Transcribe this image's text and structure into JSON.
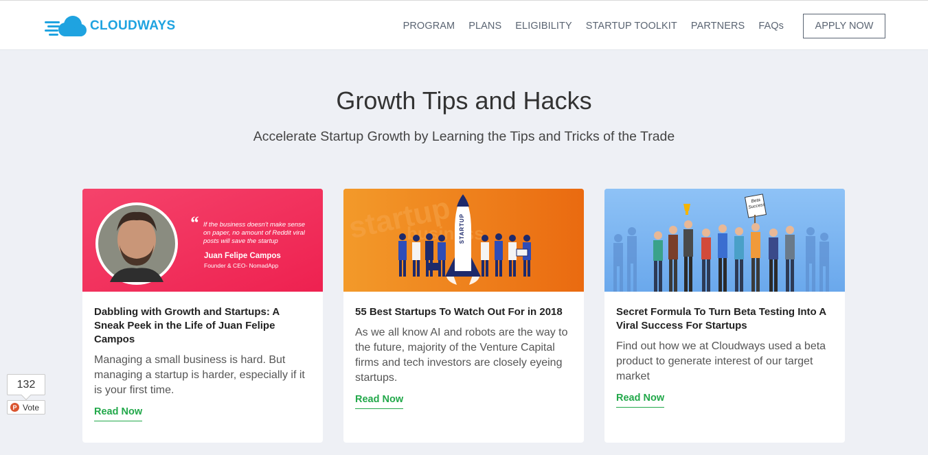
{
  "header": {
    "logo_text": "CLOUDWAYS",
    "nav": [
      "PROGRAM",
      "PLANS",
      "ELIGIBILITY",
      "STARTUP TOOLKIT",
      "PARTNERS",
      "FAQs"
    ],
    "apply_label": "APPLY NOW"
  },
  "hero": {
    "title": "Growth Tips and Hacks",
    "subtitle": "Accelerate Startup Growth by Learning the Tips and Tricks of the Trade"
  },
  "cards": [
    {
      "image": {
        "quote": "If the business doesn't make sense on paper, no amount of Reddit viral posts will save the startup",
        "name": "Juan Felipe Campos",
        "role": "Founder & CEO- NomadApp",
        "bg": "#f2305a"
      },
      "title": "Dabbling with Growth and Startups: A Sneak Peek in the Life of Juan Felipe Campos",
      "desc": "Managing a small business is hard. But managing a startup is harder, especially if it is your first time.",
      "read": "Read Now"
    },
    {
      "image": {
        "rocket_text": "STARTUP",
        "bg_word": "startup",
        "bg_word2": "business",
        "bg": "#f07f1a"
      },
      "title": "55 Best Startups To Watch Out For in 2018",
      "desc": "As we all know AI and robots are the way to the future, majority of the Venture Capital firms and tech investors are closely eyeing startups.",
      "read": "Read Now"
    },
    {
      "image": {
        "sign_text": "Beta Success",
        "bg": "#78b4f2"
      },
      "title": "Secret Formula To Turn Beta Testing Into A Viral Success For Startups",
      "desc": "Find out how we at Cloudways used a beta product to generate interest of our target market",
      "read": "Read Now"
    }
  ],
  "vote": {
    "count": "132",
    "label": "Vote",
    "icon": "P"
  },
  "colors": {
    "brand": "#1fa3e0",
    "accent_green": "#22a84a",
    "page_bg": "#eef0f5"
  }
}
